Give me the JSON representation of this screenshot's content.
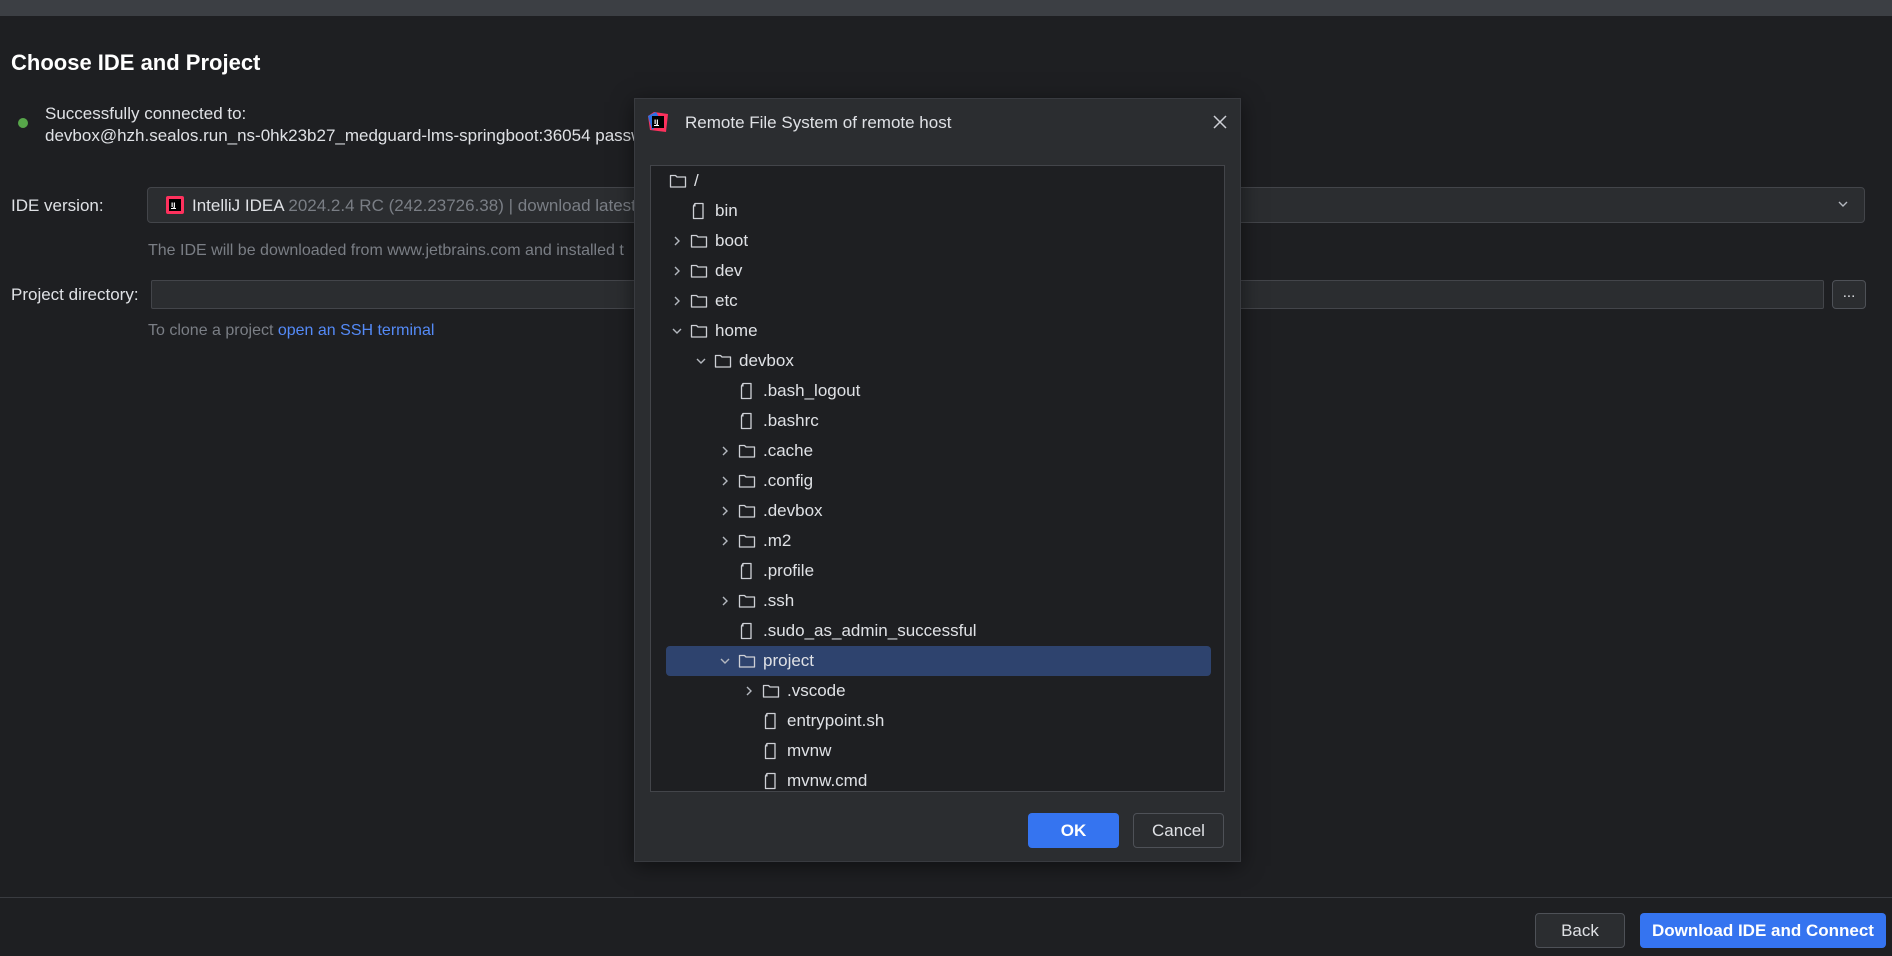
{
  "page": {
    "title": "Choose IDE and Project",
    "connection": {
      "line1": "Successfully connected to:",
      "line2": "devbox@hzh.sealos.run_ns-0hk23b27_medguard-lms-springboot:36054 passw"
    },
    "ide_version": {
      "label": "IDE version:",
      "name": "IntelliJ IDEA",
      "version": "2024.2.4 RC (242.23726.38) | download latest",
      "hint": "The IDE will be downloaded from www.jetbrains.com and installed t"
    },
    "project_directory": {
      "label": "Project directory:",
      "value": "",
      "browse_label": "...",
      "hint_prefix": "To clone a project ",
      "hint_link": "open an SSH terminal"
    },
    "footer": {
      "back_label": "Back",
      "primary_label": "Download IDE and Connect"
    }
  },
  "dialog": {
    "title": "Remote File System of remote host",
    "ok_label": "OK",
    "cancel_label": "Cancel",
    "tree": [
      {
        "name": "/",
        "type": "folder",
        "depth": 0,
        "expander": "none"
      },
      {
        "name": "bin",
        "type": "file",
        "depth": 1,
        "expander": "none"
      },
      {
        "name": "boot",
        "type": "folder",
        "depth": 1,
        "expander": "collapsed"
      },
      {
        "name": "dev",
        "type": "folder",
        "depth": 1,
        "expander": "collapsed"
      },
      {
        "name": "etc",
        "type": "folder",
        "depth": 1,
        "expander": "collapsed"
      },
      {
        "name": "home",
        "type": "folder",
        "depth": 1,
        "expander": "expanded"
      },
      {
        "name": "devbox",
        "type": "folder",
        "depth": 2,
        "expander": "expanded"
      },
      {
        "name": ".bash_logout",
        "type": "file",
        "depth": 3,
        "expander": "none"
      },
      {
        "name": ".bashrc",
        "type": "file",
        "depth": 3,
        "expander": "none"
      },
      {
        "name": ".cache",
        "type": "folder",
        "depth": 3,
        "expander": "collapsed"
      },
      {
        "name": ".config",
        "type": "folder",
        "depth": 3,
        "expander": "collapsed"
      },
      {
        "name": ".devbox",
        "type": "folder",
        "depth": 3,
        "expander": "collapsed"
      },
      {
        "name": ".m2",
        "type": "folder",
        "depth": 3,
        "expander": "collapsed"
      },
      {
        "name": ".profile",
        "type": "file",
        "depth": 3,
        "expander": "none"
      },
      {
        "name": ".ssh",
        "type": "folder",
        "depth": 3,
        "expander": "collapsed"
      },
      {
        "name": ".sudo_as_admin_successful",
        "type": "file",
        "depth": 3,
        "expander": "none"
      },
      {
        "name": "project",
        "type": "folder",
        "depth": 3,
        "expander": "expanded",
        "selected": true
      },
      {
        "name": ".vscode",
        "type": "folder",
        "depth": 4,
        "expander": "collapsed"
      },
      {
        "name": "entrypoint.sh",
        "type": "file",
        "depth": 4,
        "expander": "none"
      },
      {
        "name": "mvnw",
        "type": "file",
        "depth": 4,
        "expander": "none"
      },
      {
        "name": "mvnw.cmd",
        "type": "file",
        "depth": 4,
        "expander": "none"
      }
    ]
  },
  "icons": {
    "status": "connected-dot-icon",
    "ide": "intellij-idea-icon",
    "folder": "folder-icon",
    "file": "file-icon",
    "close": "close-icon",
    "chevron": "chevron-icon"
  },
  "colors": {
    "accent": "#3574f0",
    "background": "#1e1f22",
    "panel": "#2b2d30",
    "selection": "#2e436e",
    "link": "#548af7",
    "status_ok": "#57a64a"
  }
}
